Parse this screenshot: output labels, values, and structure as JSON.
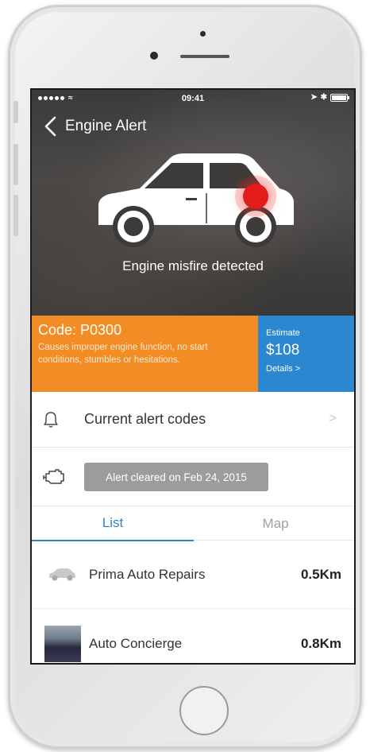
{
  "status_bar": {
    "time": "09:41"
  },
  "nav": {
    "title": "Engine Alert"
  },
  "hero": {
    "caption": "Engine misfire detected"
  },
  "code_panel": {
    "title": "Code: P0300",
    "description": "Causes improper engine function, no start conditions, stumbles or hesitations."
  },
  "estimate_panel": {
    "label": "Estimate",
    "value": "$108",
    "link": "Details >"
  },
  "alerts_row": {
    "label": "Current alert codes",
    "chevron": ">"
  },
  "engine_row": {
    "status": "Alert cleared on Feb 24, 2015"
  },
  "tabs": [
    {
      "label": "List",
      "active": true
    },
    {
      "label": "Map",
      "active": false
    }
  ],
  "shops": [
    {
      "name": "Prima Auto Repairs",
      "distance": "0.5Km",
      "thumbnail": "car-outline-icon"
    },
    {
      "name": "Auto Concierge",
      "distance": "0.8Km",
      "thumbnail": "shop-photo"
    }
  ],
  "colors": {
    "orange": "#f28c25",
    "blue": "#2b87cf",
    "alert_red": "#e21b1b",
    "chip_gray": "#9c9c9c"
  }
}
